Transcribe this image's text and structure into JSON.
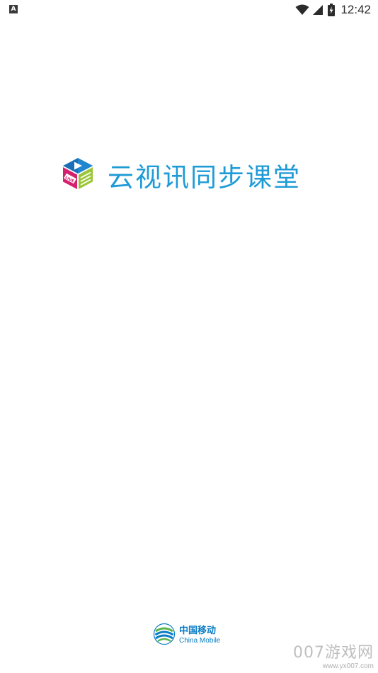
{
  "status_bar": {
    "notification_badge": "A",
    "time": "12:42",
    "icons": [
      "wifi-icon",
      "cellular-signal-icon",
      "battery-charging-icon"
    ]
  },
  "splash": {
    "app_name": "云视讯同步课堂",
    "logo_badge_text": "LIVE",
    "brand_color": "#1e9bd6"
  },
  "carrier": {
    "name_cn": "中国移动",
    "name_en": "China Mobile",
    "color": "#0a7cc4"
  },
  "watermark": {
    "text": "007游戏网",
    "url": "www.yx007.com"
  }
}
